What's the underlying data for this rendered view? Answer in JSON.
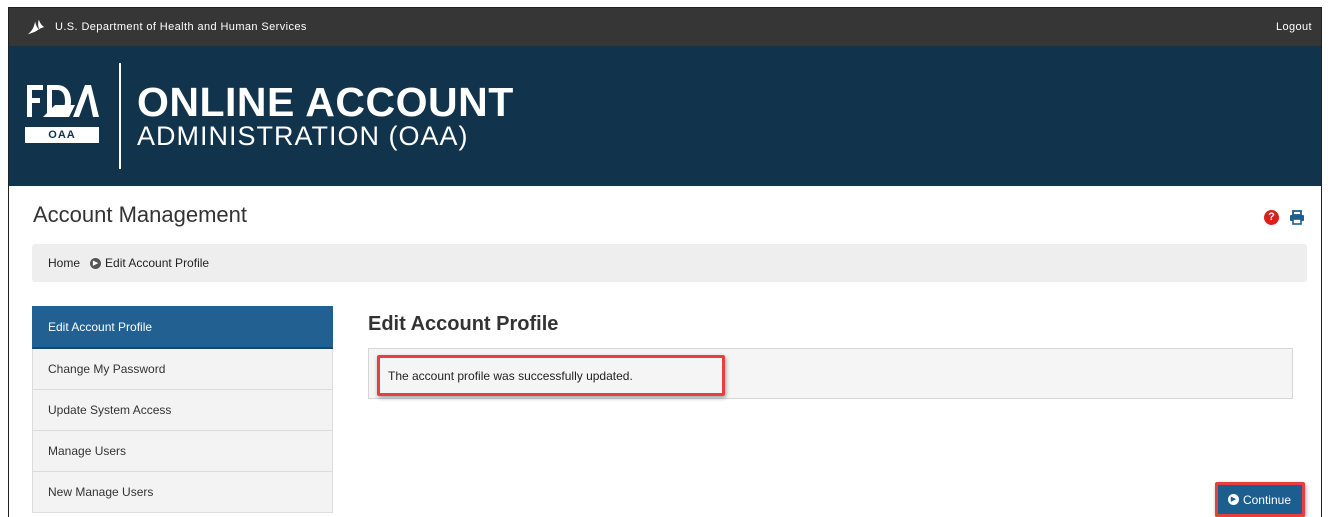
{
  "topbar": {
    "agency": "U.S. Department of Health and Human Services",
    "logout": "Logout"
  },
  "banner": {
    "logo_badge": "OAA",
    "title_line1": "ONLINE ACCOUNT",
    "title_line2": "ADMINISTRATION (OAA)"
  },
  "page": {
    "title": "Account Management",
    "help_icon": "question-circle",
    "print_icon": "printer"
  },
  "breadcrumb": {
    "home": "Home",
    "current": "Edit Account Profile"
  },
  "sidebar": {
    "items": [
      {
        "label": "Edit Account Profile",
        "active": true
      },
      {
        "label": "Change My Password",
        "active": false
      },
      {
        "label": "Update System Access",
        "active": false
      },
      {
        "label": "Manage Users",
        "active": false
      },
      {
        "label": "New Manage Users",
        "active": false
      }
    ]
  },
  "main": {
    "heading": "Edit Account Profile",
    "message": "The account profile was successfully updated.",
    "continue_label": "Continue"
  },
  "colors": {
    "topbar_bg": "#363636",
    "banner_bg": "#11334b",
    "active_nav": "#216091",
    "highlight_border": "#e53f3f",
    "help_red": "#d9201a"
  }
}
